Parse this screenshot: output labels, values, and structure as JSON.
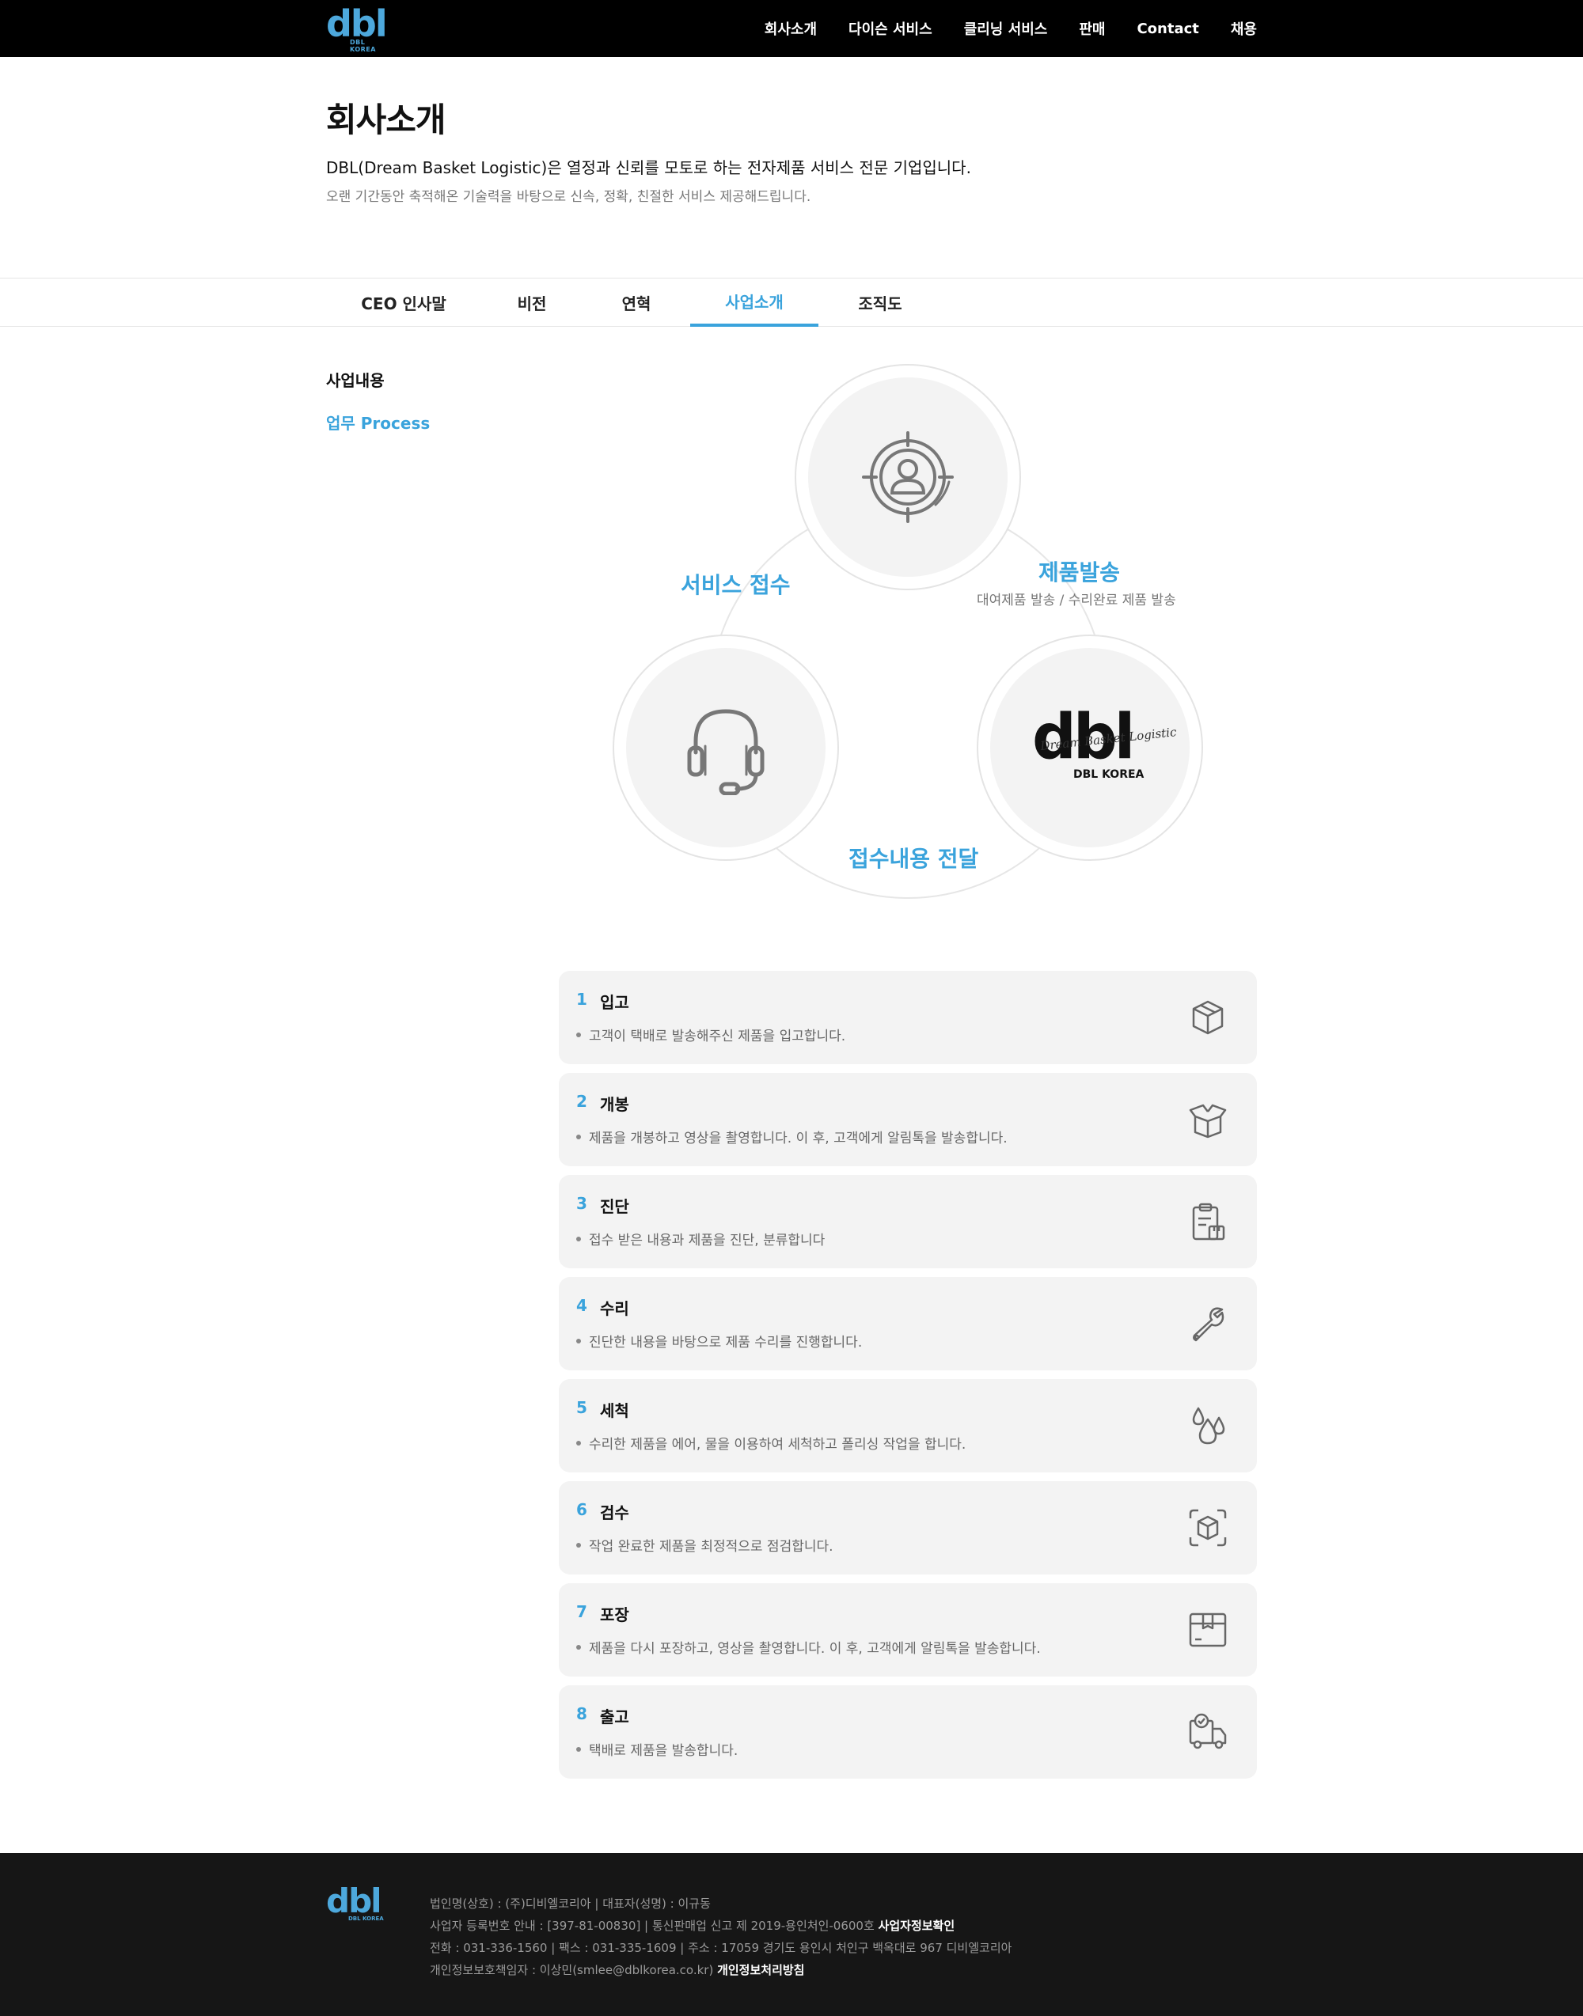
{
  "header": {
    "logo_text": "dbl",
    "logo_sub": "DBL KOREA",
    "nav": [
      "회사소개",
      "다이슨 서비스",
      "클리닝 서비스",
      "판매",
      "Contact",
      "채용"
    ]
  },
  "page": {
    "title": "회사소개",
    "intro_main": "DBL(Dream Basket Logistic)은 열정과 신뢰를 모토로 하는 전자제품 서비스 전문 기업입니다.",
    "intro_sub": "오랜 기간동안 축적해온 기술력을 바탕으로 신속, 정확, 친절한 서비스 제공해드립니다."
  },
  "tabs": [
    "CEO 인사말",
    "비전",
    "연혁",
    "사업소개",
    "조직도"
  ],
  "active_tab": "사업소개",
  "side": {
    "title": "사업내용",
    "link": "업무 Process"
  },
  "diagram": {
    "label_left": "서비스 접수",
    "label_right": "제품발송",
    "label_right_desc": "대여제품 발송 / 수리완료 제품 발송",
    "label_bottom": "접수내용 전달",
    "logo_text": "dbl",
    "logo_script": "Dream Basket Logistic",
    "logo_sub": "DBL KOREA",
    "icons": [
      "target-user-icon",
      "headset-icon",
      "dbl-logo"
    ]
  },
  "process": [
    {
      "num": "1",
      "title": "입고",
      "desc": "고객이 택배로 발송해주신 제품을 입고합니다.",
      "icon": "box-icon"
    },
    {
      "num": "2",
      "title": "개봉",
      "desc": "제품을 개봉하고 영상을 촬영합니다. 이 후, 고객에게 알림톡을 발송합니다.",
      "icon": "open-box-icon"
    },
    {
      "num": "3",
      "title": "진단",
      "desc": "접수 받은 내용과 제품을 진단, 분류합니다",
      "icon": "clipboard-icon"
    },
    {
      "num": "4",
      "title": "수리",
      "desc": "진단한 내용을 바탕으로 제품 수리를 진행합니다.",
      "icon": "wrench-icon"
    },
    {
      "num": "5",
      "title": "세척",
      "desc": "수리한 제품을 에어, 물을 이용하여 세척하고 폴리싱 작업을 합니다.",
      "icon": "water-drops-icon"
    },
    {
      "num": "6",
      "title": "검수",
      "desc": "작업 완료한 제품을 최정적으로 점검합니다.",
      "icon": "scan-box-icon"
    },
    {
      "num": "7",
      "title": "포장",
      "desc": "제품을 다시 포장하고, 영상을 촬영합니다. 이 후, 고객에게 알림톡을 발송합니다.",
      "icon": "package-icon"
    },
    {
      "num": "8",
      "title": "출고",
      "desc": "택배로 제품을 발송합니다.",
      "icon": "delivery-truck-icon"
    }
  ],
  "footer": {
    "logo_text": "dbl",
    "logo_sub": "DBL KOREA",
    "line1": "법인명(상호) : (주)디비엘코리아 | 대표자(성명) : 이규동",
    "line2": "사업자 등록번호 안내 : [397-81-00830] | 통신판매업 신고 제 2019-용인처인-0600호",
    "line2_link": "사업자정보확인",
    "line3": "전화 : 031-336-1560 | 팩스 : 031-335-1609 | 주소 : 17059 경기도 용인시 처인구 백옥대로 967 디비엘코리아",
    "line4": "개인정보보호책임자 : 이상민(smlee@dblkorea.co.kr)",
    "line4_link": "개인정보처리방침"
  },
  "colors": {
    "accent": "#3aa3dc",
    "header_bg": "#000000",
    "footer_bg": "#161616",
    "card_bg": "#f3f3f3"
  }
}
